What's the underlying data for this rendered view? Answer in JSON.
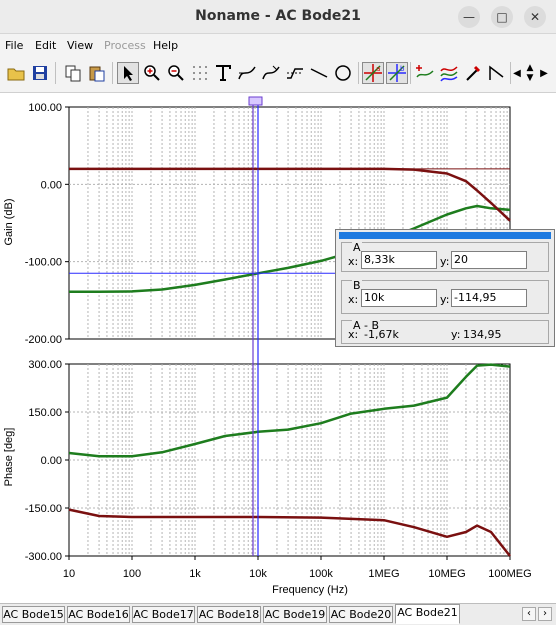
{
  "window": {
    "title": "Noname - AC Bode21",
    "minimize_icon": "minimize-icon",
    "maximize_icon": "maximize-icon",
    "close_icon": "close-icon"
  },
  "menu": {
    "file": "File",
    "edit": "Edit",
    "view": "View",
    "process": "Process",
    "help": "Help"
  },
  "toolbar": {
    "icons": [
      "open-folder-icon",
      "save-icon",
      "copy-icon",
      "paste-icon",
      "pointer-icon",
      "zoom-in-icon",
      "zoom-out-icon",
      "grid-dots-icon",
      "text-icon",
      "curve-tool-icon",
      "curve-tool-2-icon",
      "step-curve-icon",
      "line-icon",
      "circle-icon",
      "cursor-a-icon",
      "cursor-b-icon",
      "add-curve-icon",
      "curves-icon",
      "probe-icon",
      "arrow-pattern-icon",
      "scroll-left-icon",
      "scroll-updown-icon",
      "scroll-right-icon"
    ]
  },
  "colors": {
    "gain_green": "#1e7d1e",
    "dark_red": "#7a1010",
    "cursor_a": "#6a3ccf",
    "cursor_b": "#2a2aff",
    "grid": "#b4b4b4"
  },
  "gain_chart": {
    "ylabel": "Gain (dB)",
    "yticks": [
      "100.00",
      "0.00",
      "-100.00",
      "-200.00"
    ]
  },
  "phase_chart": {
    "ylabel": "Phase [deg]",
    "yticks": [
      "300.00",
      "150.00",
      "0.00",
      "-150.00",
      "-300.00"
    ]
  },
  "xaxis": {
    "label": "Frequency (Hz)",
    "ticks": [
      "10",
      "100",
      "1k",
      "10k",
      "100k",
      "1MEG",
      "10MEG",
      "100MEG"
    ]
  },
  "cursor_panel": {
    "a": {
      "title": "A",
      "x_label": "x:",
      "x": "8,33k",
      "y_label": "y:",
      "y": "20"
    },
    "b": {
      "title": "B",
      "x_label": "x:",
      "x": "10k",
      "y_label": "y:",
      "y": "-114,95"
    },
    "diff": {
      "title": "A - B",
      "x_label": "x:",
      "x": "-1,67k",
      "y_label": "y:",
      "y": "134,95"
    }
  },
  "tabs": [
    "AC Bode15",
    "AC Bode16",
    "AC Bode17",
    "AC Bode18",
    "AC Bode19",
    "AC Bode20",
    "AC Bode21"
  ],
  "active_tab": "AC Bode21",
  "chart_data": [
    {
      "type": "line",
      "title": "",
      "xlabel": "Frequency (Hz)",
      "ylabel": "Gain (dB)",
      "xscale": "log",
      "xlim": [
        10,
        100000000
      ],
      "ylim": [
        -200,
        100
      ],
      "grid": true,
      "series": [
        {
          "color": "#1e7d1e",
          "x": [
            10,
            30,
            100,
            300,
            1000,
            3000,
            10000,
            30000,
            100000,
            300000,
            1000000,
            3000000,
            10000000,
            20000000,
            30000000,
            50000000,
            100000000
          ],
          "y": [
            -139,
            -139,
            -138.5,
            -136,
            -130,
            -123,
            -115,
            -108,
            -99,
            -88,
            -72,
            -57,
            -39,
            -31,
            -28,
            -31,
            -33
          ]
        },
        {
          "color": "#7a1010",
          "x": [
            10,
            100,
            1000,
            10000,
            100000,
            1000000,
            3000000,
            10000000,
            20000000,
            30000000,
            50000000,
            100000000
          ],
          "y": [
            20,
            20,
            20,
            20,
            20,
            20,
            19,
            14,
            4,
            -8,
            -24,
            -47
          ]
        }
      ],
      "cursors": {
        "A": {
          "x": 8330,
          "y": 20
        },
        "B": {
          "x": 10000,
          "y": -114.95
        }
      },
      "yticks": [
        "100.00",
        "0.00",
        "-100.00",
        "-200.00"
      ]
    },
    {
      "type": "line",
      "title": "",
      "xlabel": "Frequency (Hz)",
      "ylabel": "Phase [deg]",
      "xscale": "log",
      "xlim": [
        10,
        100000000
      ],
      "ylim": [
        -300,
        300
      ],
      "grid": true,
      "series": [
        {
          "color": "#1e7d1e",
          "x": [
            10,
            30,
            100,
            300,
            1000,
            3000,
            10000,
            30000,
            100000,
            300000,
            1000000,
            3000000,
            10000000,
            20000000,
            30000000,
            50000000,
            100000000
          ],
          "y": [
            22,
            12,
            12,
            24,
            50,
            75,
            88,
            95,
            115,
            145,
            160,
            170,
            195,
            260,
            295,
            298,
            292
          ]
        },
        {
          "color": "#7a1010",
          "x": [
            10,
            30,
            100,
            1000,
            10000,
            100000,
            1000000,
            3000000,
            10000000,
            20000000,
            30000000,
            50000000,
            100000000
          ],
          "y": [
            -155,
            -175,
            -178,
            -178,
            -178,
            -180,
            -188,
            -210,
            -240,
            -225,
            -205,
            -225,
            -300
          ]
        }
      ],
      "yticks": [
        "300.00",
        "150.00",
        "0.00",
        "-150.00",
        "-300.00"
      ]
    }
  ]
}
